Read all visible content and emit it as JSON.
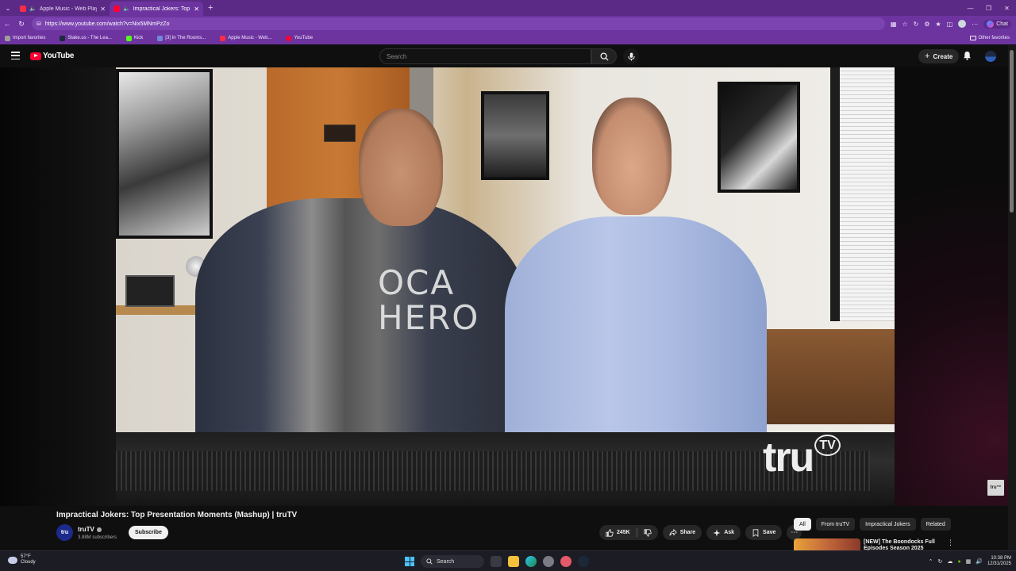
{
  "browser": {
    "tabs": [
      {
        "title": "Apple Music - Web Player",
        "active": false,
        "audio": true
      },
      {
        "title": "Impractical Jokers: Top Presentation Moments (Mashup) | truTV",
        "active": true,
        "audio": true
      }
    ],
    "url": "https://www.youtube.com/watch?v=Nix5MNmPzZo",
    "chat_label": "Chat",
    "bookmarks": [
      {
        "label": "Import favorites",
        "color": "#9e9e9e"
      },
      {
        "label": "Stake.us - The Lea...",
        "color": "#1a2c38"
      },
      {
        "label": "Kick",
        "color": "#53fc18"
      },
      {
        "label": "[3] In The Rooms...",
        "color": "#7289da"
      },
      {
        "label": "Apple Music - Web...",
        "color": "#fa2d48"
      },
      {
        "label": "YouTube",
        "color": "#ff0033"
      }
    ],
    "other_favorites": "Other favorites"
  },
  "youtube": {
    "logo_text": "YouTube",
    "search_placeholder": "Search",
    "create_label": "Create"
  },
  "video": {
    "title": "Impractical Jokers: Top Presentation Moments (Mashup) | truTV",
    "shirt_text": "OCA\nHERO",
    "overlay_logo": "tru",
    "overlay_logo_tv": "TV",
    "watermark": "tru™"
  },
  "channel": {
    "avatar_text": "tru",
    "name": "truTV",
    "subscribers": "3.88M subscribers",
    "subscribe_label": "Subscribe"
  },
  "actions": {
    "likes": "245K",
    "share_label": "Share",
    "ask_label": "Ask",
    "save_label": "Save"
  },
  "chips": [
    "All",
    "From truTV",
    "Impractical Jokers",
    "Related"
  ],
  "recommendation": {
    "title": "[NEW] The Boondocks Full Episodes Season 2025"
  },
  "taskbar": {
    "temperature": "57°F",
    "condition": "Cloudy",
    "search_label": "Search",
    "time": "10:38 PM",
    "date": "12/31/2025"
  },
  "colors": {
    "browser_tabbar": "#5b2a86",
    "browser_toolbar": "#6d34a0",
    "youtube_bg": "#0f0f0f",
    "youtube_red": "#ff0033"
  }
}
